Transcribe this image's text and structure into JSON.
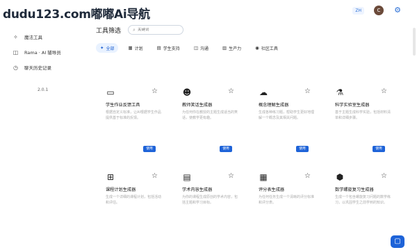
{
  "watermark": "dudu123.com嘟嘟Ai导航",
  "sidebar": {
    "items": [
      {
        "label": "魔法工具",
        "icon": "sparkle-icon",
        "glyph": "✧"
      },
      {
        "label": "Rama · AI 辅导员",
        "icon": "chat-icon",
        "glyph": "◫"
      },
      {
        "label": "聊天历史记录",
        "icon": "history-icon",
        "glyph": "◷"
      }
    ],
    "version": "2.0.1"
  },
  "header": {
    "lang": "ZH",
    "avatar_letter": "C"
  },
  "filter": {
    "title": "工具筛选",
    "search_placeholder": "关键词"
  },
  "tabs": [
    {
      "label": "全部",
      "icon": "sparkle-icon",
      "glyph": "✦"
    },
    {
      "label": "计划",
      "icon": "calendar-icon",
      "glyph": "▦"
    },
    {
      "label": "学生支持",
      "icon": "book-icon",
      "glyph": "▤"
    },
    {
      "label": "沟通",
      "icon": "message-icon",
      "glyph": "◫"
    },
    {
      "label": "生产力",
      "icon": "chart-icon",
      "glyph": "▥"
    },
    {
      "label": "社区工具",
      "icon": "community-icon",
      "glyph": "◉"
    }
  ],
  "cards": [
    {
      "title": "学生作业反馈工具",
      "desc": "根据自定义标准，让AI根据学生作品提供基于标准的反馈。",
      "icon": "book-open-icon",
      "glyph": "▭"
    },
    {
      "title": "教师笑话生成器",
      "desc": "为任何你在教授的主题生成适当的笑话，使教学更有趣。",
      "icon": "laughing-face-icon",
      "glyph": "☻"
    },
    {
      "title": "概念理解生成器",
      "desc": "生成各种练习题，帮助学生更好地理解一个概念及其相关问题。",
      "icon": "cloud-icon",
      "glyph": "☁"
    },
    {
      "title": "科学实验室生成器",
      "desc": "基于主题生成科学实验，包括材料清单和详细步骤。",
      "icon": "flask-icon",
      "glyph": "⚗"
    },
    {
      "title": "课程计划生成器",
      "desc": "生成一个详细的课程计划，包括活动和评估。",
      "icon": "plan-icon",
      "glyph": "⊞"
    },
    {
      "title": "学术内容生成器",
      "desc": "为你的课程生成原创的学术内容，包括主题和学习目标。",
      "icon": "document-icon",
      "glyph": "▤"
    },
    {
      "title": "评分表生成器",
      "desc": "为任何任务生成一个清晰的评分标准和评分表。",
      "icon": "grid-icon",
      "glyph": "▦"
    },
    {
      "title": "数学螺旋复习生成器",
      "desc": "生成一个包含螺旋复习问题的数学练习，以巩固学生之前学到的知识。",
      "icon": "math-icon",
      "glyph": "⬢"
    }
  ],
  "use_label": "使用"
}
